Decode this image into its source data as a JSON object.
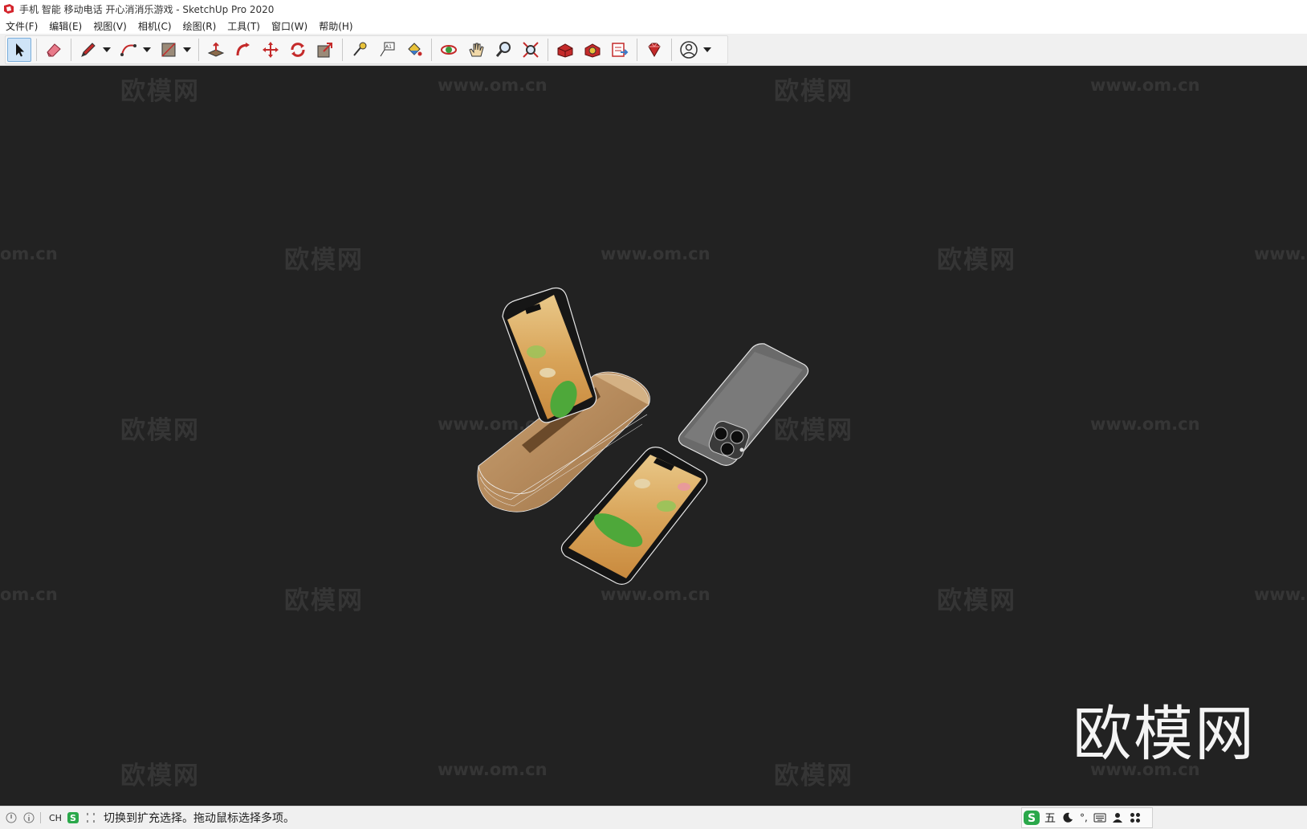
{
  "window": {
    "title": "手机 智能 移动电话 开心消消乐游戏 - SketchUp Pro 2020"
  },
  "menu": [
    "文件(F)",
    "编辑(E)",
    "视图(V)",
    "相机(C)",
    "绘图(R)",
    "工具(T)",
    "窗口(W)",
    "帮助(H)"
  ],
  "toolbar": {
    "tools": [
      {
        "name": "select-tool",
        "icon": "arrow-cursor-icon",
        "active": true
      },
      {
        "name": "eraser-tool",
        "icon": "eraser-icon"
      },
      {
        "name": "line-tool",
        "icon": "pencil-icon",
        "caret": true
      },
      {
        "name": "arc-tool",
        "icon": "arc-icon",
        "caret": true
      },
      {
        "name": "shape-tool",
        "icon": "rectangle-icon",
        "caret": true
      },
      {
        "name": "push-pull-tool",
        "icon": "push-pull-icon"
      },
      {
        "name": "follow-me-tool",
        "icon": "follow-me-icon"
      },
      {
        "name": "move-tool",
        "icon": "move-icon"
      },
      {
        "name": "rotate-tool",
        "icon": "rotate-icon"
      },
      {
        "name": "scale-tool",
        "icon": "scale-icon"
      },
      {
        "name": "tape-measure-tool",
        "icon": "tape-measure-icon"
      },
      {
        "name": "text-tool",
        "icon": "text-icon"
      },
      {
        "name": "paint-bucket-tool",
        "icon": "paint-bucket-icon"
      },
      {
        "name": "orbit-tool",
        "icon": "orbit-icon"
      },
      {
        "name": "pan-tool",
        "icon": "hand-icon"
      },
      {
        "name": "zoom-tool",
        "icon": "magnifier-icon"
      },
      {
        "name": "zoom-extents-tool",
        "icon": "zoom-extents-icon"
      },
      {
        "name": "warehouse-tool",
        "icon": "warehouse-icon"
      },
      {
        "name": "extension-warehouse-tool",
        "icon": "extension-warehouse-icon"
      },
      {
        "name": "layout-tool",
        "icon": "send-to-layout-icon"
      },
      {
        "name": "ruby-console-tool",
        "icon": "ruby-icon"
      },
      {
        "name": "account-tool",
        "icon": "user-account-icon",
        "caret": true
      }
    ]
  },
  "watermarks": {
    "cn": "欧模网",
    "url": "www.om.cn",
    "url_partial_left": "om.cn",
    "url_partial_right": "www.",
    "big": "欧模网"
  },
  "status": {
    "ime_label": "CH",
    "message": "切换到扩充选择。拖动鼠标选择多项。"
  },
  "ime": {
    "mode": "五",
    "punct": "°,"
  }
}
